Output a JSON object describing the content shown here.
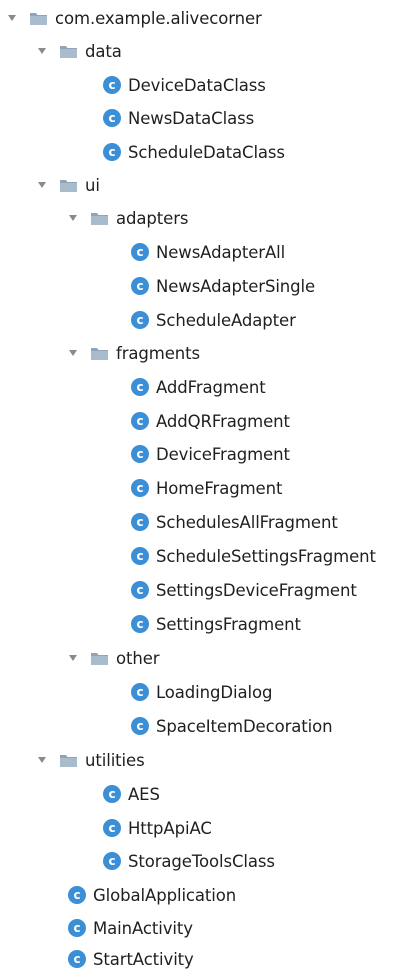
{
  "project_tree": {
    "root": {
      "label": "com.example.alivecorner",
      "icon": "folder-icon",
      "expanded": true
    },
    "data": {
      "label": "data",
      "icon": "folder-icon",
      "expanded": true,
      "items": [
        "DeviceDataClass",
        "NewsDataClass",
        "ScheduleDataClass"
      ]
    },
    "ui": {
      "label": "ui",
      "icon": "folder-icon",
      "expanded": true,
      "adapters": {
        "label": "adapters",
        "icon": "folder-icon",
        "expanded": true,
        "items": [
          "NewsAdapterAll",
          "NewsAdapterSingle",
          "ScheduleAdapter"
        ]
      },
      "fragments": {
        "label": "fragments",
        "icon": "folder-icon",
        "expanded": true,
        "items": [
          "AddFragment",
          "AddQRFragment",
          "DeviceFragment",
          "HomeFragment",
          "SchedulesAllFragment",
          "ScheduleSettingsFragment",
          "SettingsDeviceFragment",
          "SettingsFragment"
        ]
      },
      "other": {
        "label": "other",
        "icon": "folder-icon",
        "expanded": true,
        "items": [
          "LoadingDialog",
          "SpaceItemDecoration"
        ]
      }
    },
    "utilities": {
      "label": "utilities",
      "icon": "folder-icon",
      "expanded": true,
      "items": [
        "AES",
        "HttpApiAC",
        "StorageToolsClass"
      ]
    },
    "root_classes": [
      "GlobalApplication",
      "MainActivity",
      "StartActivity"
    ],
    "class_icon_letter": "c",
    "colors": {
      "class_icon": "#3a8fd6",
      "folder_body": "#8fa4b8",
      "folder_tab": "#a9bccd",
      "arrow": "#8a8a8a",
      "text": "#1f1f1f"
    }
  }
}
